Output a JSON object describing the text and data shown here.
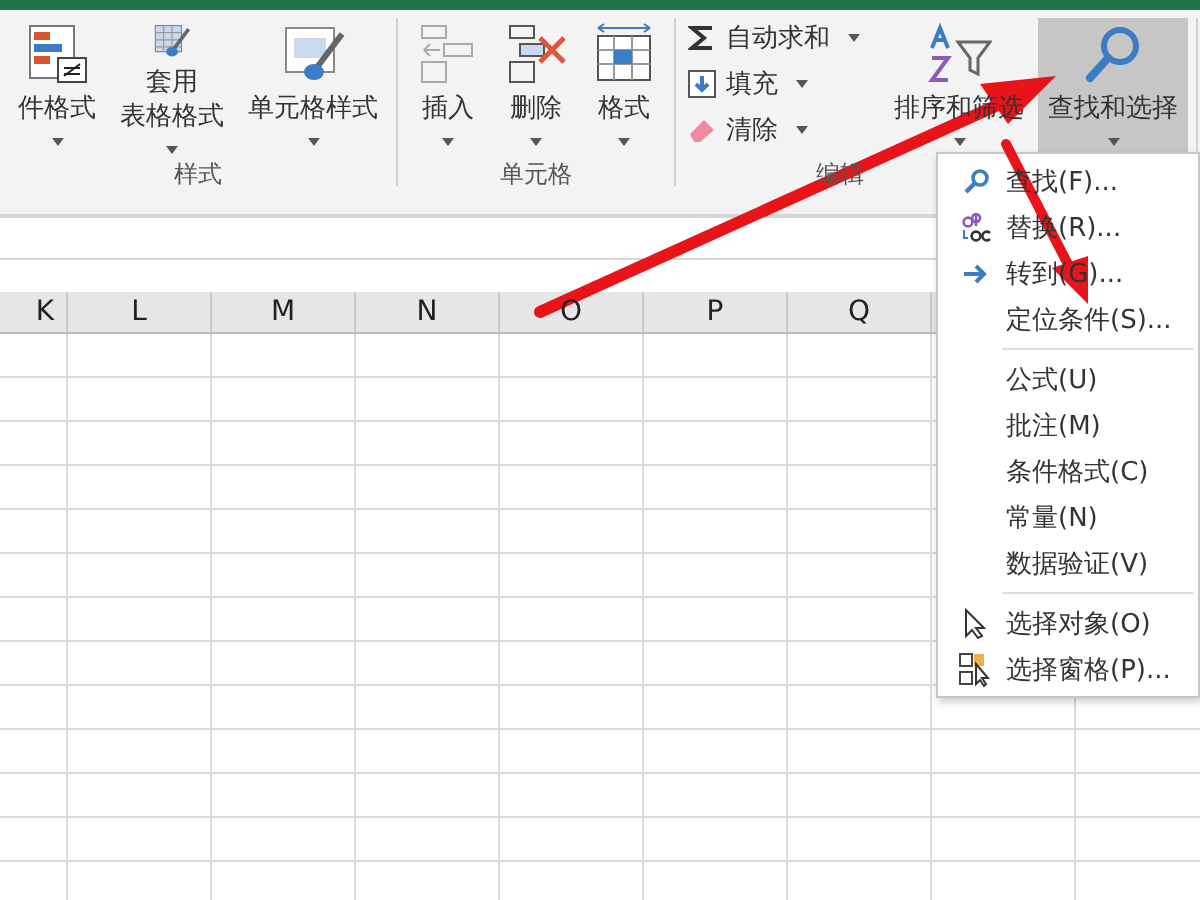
{
  "ribbon": {
    "groups": [
      {
        "label": "样式",
        "large": [
          {
            "lines": [
              "件格式"
            ],
            "pressed": false
          },
          {
            "lines": [
              "套用",
              "表格格式"
            ],
            "pressed": false
          },
          {
            "lines": [
              "单元格样式"
            ],
            "pressed": false
          }
        ]
      },
      {
        "label": "单元格",
        "large": [
          {
            "lines": [
              "插入"
            ],
            "pressed": false
          },
          {
            "lines": [
              "删除"
            ],
            "pressed": false
          },
          {
            "lines": [
              "格式"
            ],
            "pressed": false
          }
        ]
      },
      {
        "label": "编辑",
        "small": [
          {
            "label": "自动求和"
          },
          {
            "label": "填充"
          },
          {
            "label": "清除"
          }
        ],
        "large": [
          {
            "lines": [
              "排序和筛选"
            ],
            "pressed": false
          },
          {
            "lines": [
              "查找和选择"
            ],
            "pressed": true
          }
        ]
      }
    ]
  },
  "columns": [
    "K",
    "L",
    "M",
    "N",
    "O",
    "P",
    "Q"
  ],
  "menu": {
    "sections": [
      [
        {
          "label": "查找(F)..."
        },
        {
          "label": "替换(R)..."
        },
        {
          "label": "转到(G)..."
        },
        {
          "label": "定位条件(S)..."
        }
      ],
      [
        {
          "label": "公式(U)"
        },
        {
          "label": "批注(M)"
        },
        {
          "label": "条件格式(C)"
        },
        {
          "label": "常量(N)"
        },
        {
          "label": "数据验证(V)"
        }
      ],
      [
        {
          "label": "选择对象(O)"
        },
        {
          "label": "选择窗格(P)..."
        }
      ]
    ]
  }
}
